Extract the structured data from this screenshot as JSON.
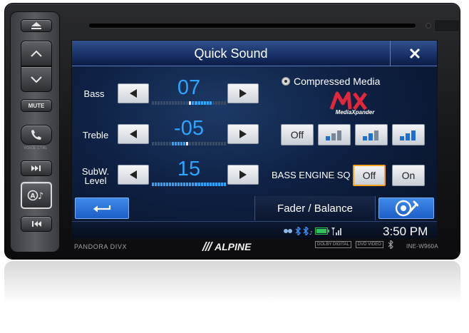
{
  "screen": {
    "title": "Quick Sound",
    "close_icon": "close-x-icon",
    "bass": {
      "label": "Bass",
      "value": "07"
    },
    "treble": {
      "label": "Treble",
      "value": "-05"
    },
    "subw": {
      "label_line1": "SubW.",
      "label_line2": "Level",
      "value": "15"
    },
    "compressed_media": "Compressed Media",
    "mx_logo_text": "MX",
    "mx_logo_sub": "MediaXpander",
    "mx_off_label": "Off",
    "bass_engine": {
      "label": "BASS ENGINE SQ",
      "off_label": "Off",
      "on_label": "On",
      "selected": "Off"
    },
    "fader_balance": "Fader / Balance",
    "clock": "3:50 PM",
    "accent_color": "#2ea4ff",
    "selection_color": "#f2a21b"
  },
  "hardware": {
    "mute_label": "MUTE",
    "voice_ctrl_label": "VOICE CTRL",
    "brand_left": "PANDORA DIVX",
    "brand_logo": "ALPINE",
    "model": "INE-W960A",
    "dolby_label": "DOLBY DIGITAL",
    "dvd_label": "DVD VIDEO"
  }
}
